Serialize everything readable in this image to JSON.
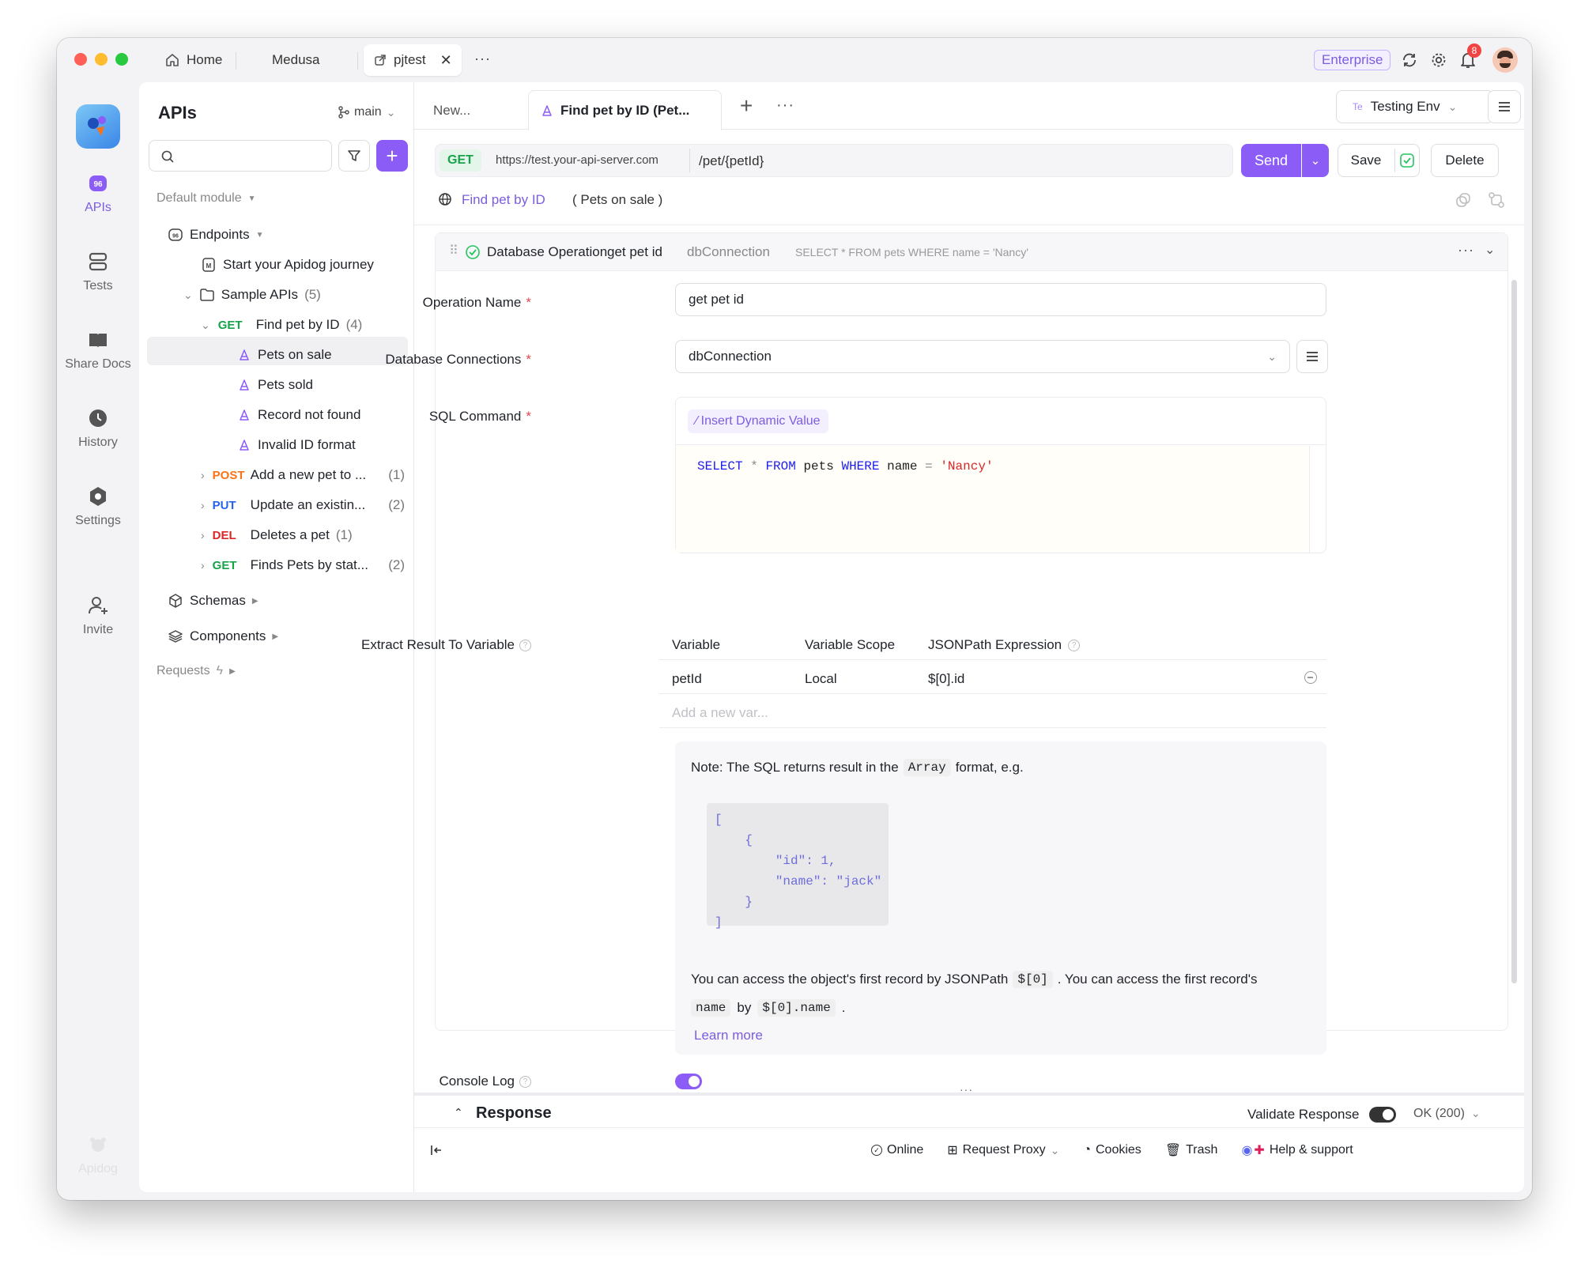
{
  "window": {
    "tabs": [
      {
        "label": "Home"
      },
      {
        "label": "Medusa"
      },
      {
        "label": "pjtest"
      }
    ],
    "enterprise_badge": "Enterprise",
    "notification_count": "8"
  },
  "nav": {
    "items": [
      {
        "label": "APIs"
      },
      {
        "label": "Tests"
      },
      {
        "label": "Share Docs"
      },
      {
        "label": "History"
      },
      {
        "label": "Settings"
      },
      {
        "label": "Invite"
      }
    ],
    "brand": "Apidog"
  },
  "sidebar": {
    "title": "APIs",
    "branch": "main",
    "module": "Default module",
    "endpoints_label": "Endpoints",
    "items": [
      {
        "label": "Start your Apidog journey"
      },
      {
        "label": "Sample APIs",
        "count": "(5)"
      },
      {
        "method": "GET",
        "label": "Find pet by ID",
        "count": "(4)"
      },
      {
        "label": "Pets on sale"
      },
      {
        "label": "Pets sold"
      },
      {
        "label": "Record not found"
      },
      {
        "label": "Invalid ID format"
      },
      {
        "method": "POST",
        "label": "Add a new pet to ...",
        "count": "(1)"
      },
      {
        "method": "PUT",
        "label": "Update an existin...",
        "count": "(2)"
      },
      {
        "method": "DEL",
        "label": "Deletes a pet",
        "count": "(1)"
      },
      {
        "method": "GET",
        "label": "Finds Pets by stat...",
        "count": "(2)"
      }
    ],
    "schemas_label": "Schemas",
    "components_label": "Components",
    "requests_label": "Requests"
  },
  "editor": {
    "tabs": [
      {
        "label": "New..."
      },
      {
        "label": "Find pet by ID (Pet..."
      }
    ],
    "env": {
      "prefix": "Te",
      "label": "Testing Env"
    },
    "request": {
      "method": "GET",
      "base_url": "https://test.your-api-server.com",
      "path": "/pet/{petId}",
      "send_label": "Send",
      "save_label": "Save",
      "delete_label": "Delete"
    },
    "breadcrumb": {
      "endpoint": "Find pet by ID",
      "example": "( Pets on sale )"
    },
    "operation": {
      "type": "Database Operation",
      "name": "get pet id",
      "connection": "dbConnection",
      "sql_preview": "SELECT * FROM pets WHERE name = 'Nancy'"
    },
    "form": {
      "operation_name_label": "Operation Name",
      "operation_name_value": "get pet id",
      "db_conn_label": "Database Connections",
      "db_conn_value": "dbConnection",
      "sql_label": "SQL Command",
      "insert_dynamic": "Insert Dynamic Value",
      "sql": {
        "kw1": "SELECT",
        "star": "*",
        "kw2": "FROM",
        "table": "pets",
        "kw3": "WHERE",
        "col": "name",
        "eq": "=",
        "val": "'Nancy'"
      },
      "extract_label": "Extract Result To Variable",
      "extract_headers": [
        "Variable",
        "Variable Scope",
        "JSONPath Expression"
      ],
      "extract_row": {
        "variable": "petId",
        "scope": "Local",
        "path": "$[0].id"
      },
      "add_var_placeholder": "Add a new var...",
      "note": {
        "prefix": "Note: The SQL returns result in the",
        "code": "Array",
        "suffix": "format, e.g.",
        "json_lines": [
          "[",
          "    {",
          "        \"id\": 1,",
          "        \"name\": \"jack\"",
          "    }",
          "]"
        ],
        "access1": "You can access the object's first record by JSONPath",
        "access_code1": "$[0]",
        "access2": ". You can access the first record's",
        "access_code2": "name",
        "access3": "by",
        "access_code3": "$[0].name",
        "access4": ".",
        "learn_more": "Learn more"
      },
      "console_log_label": "Console Log"
    },
    "response": {
      "label": "Response",
      "validate_label": "Validate Response",
      "status": "OK (200)"
    },
    "footer": {
      "online": "Online",
      "proxy": "Request Proxy",
      "cookies": "Cookies",
      "trash": "Trash",
      "help": "Help & support"
    }
  },
  "colors": {
    "accent": "#8b5cf6",
    "get": "#17a34a",
    "post": "#f97316",
    "put": "#2563eb",
    "del": "#dc2626"
  }
}
